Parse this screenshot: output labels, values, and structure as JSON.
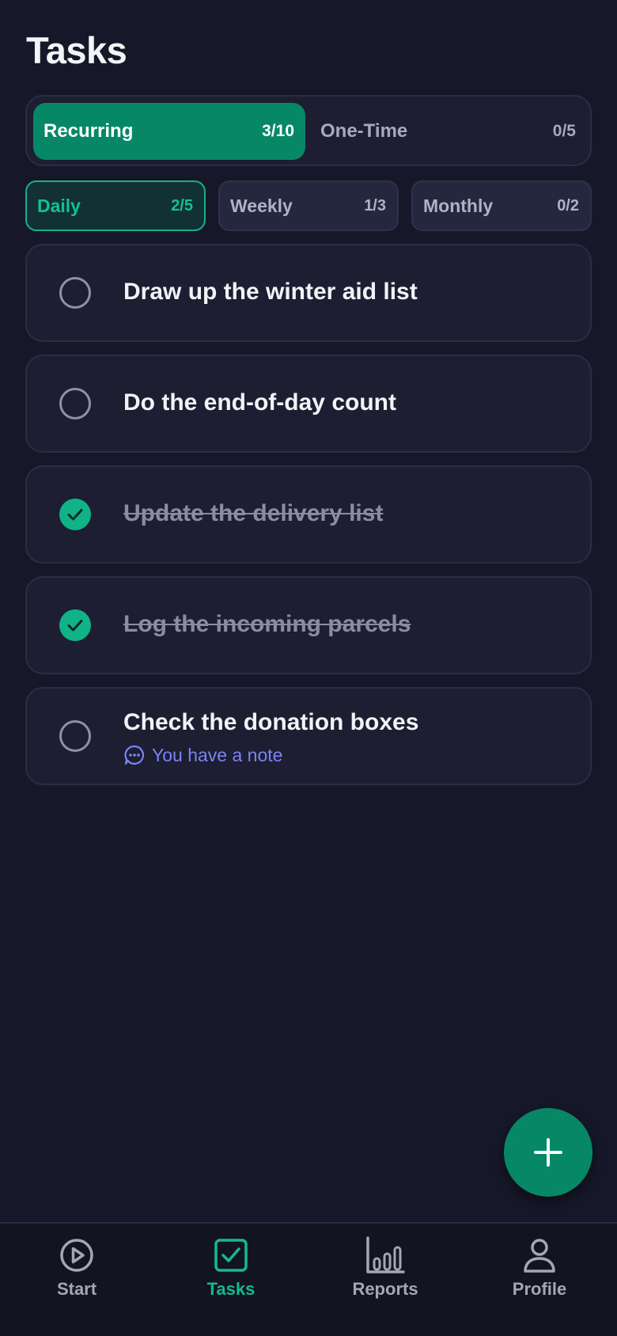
{
  "page": {
    "title": "Tasks"
  },
  "segment": {
    "recurring": {
      "label": "Recurring",
      "count": "3/10"
    },
    "onetime": {
      "label": "One-Time",
      "count": "0/5"
    }
  },
  "filters": [
    {
      "label": "Daily",
      "count": "2/5",
      "active": true
    },
    {
      "label": "Weekly",
      "count": "1/3",
      "active": false
    },
    {
      "label": "Monthly",
      "count": "0/2",
      "active": false
    }
  ],
  "tasks": [
    {
      "text": "Draw up the winter aid list",
      "done": false
    },
    {
      "text": "Do the end-of-day count",
      "done": false
    },
    {
      "text": "Update the delivery list",
      "done": true
    },
    {
      "text": "Log the incoming parcels",
      "done": true
    },
    {
      "text": "Check the donation boxes",
      "done": false,
      "note": "You have a note"
    }
  ],
  "fab": {
    "icon": "plus-icon"
  },
  "nav": [
    {
      "label": "Start",
      "icon": "play-circle-icon",
      "active": false
    },
    {
      "label": "Tasks",
      "icon": "checkbox-icon",
      "active": true
    },
    {
      "label": "Reports",
      "icon": "bar-chart-icon",
      "active": false
    },
    {
      "label": "Profile",
      "icon": "person-icon",
      "active": false
    }
  ],
  "colors": {
    "accent": "#068867",
    "accent_text": "#14b98c",
    "background": "#161728",
    "card": "#1d1e32",
    "note": "#7c83f4"
  }
}
